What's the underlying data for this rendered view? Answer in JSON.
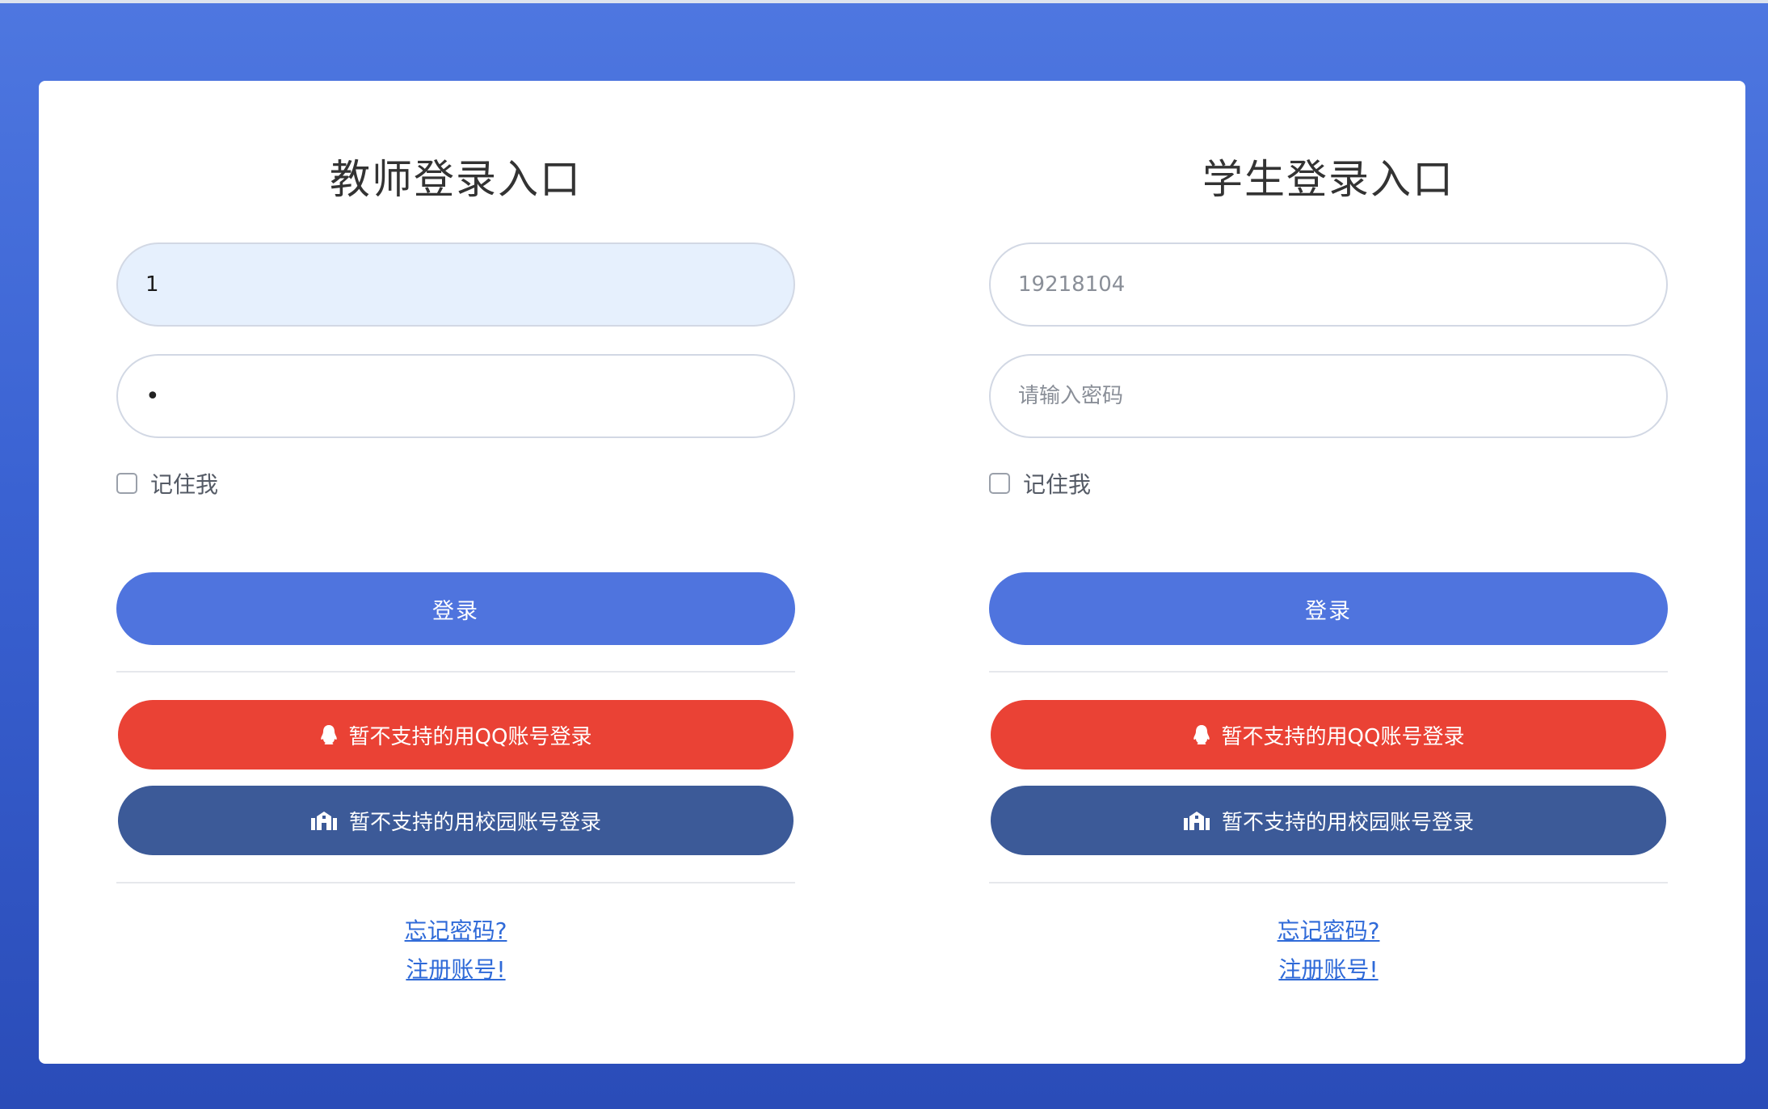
{
  "teacher": {
    "title": "教师登录入口",
    "username_value": "1",
    "password_value": "•",
    "remember_label": "记住我",
    "login_label": "登录",
    "qq_label": "暂不支持的用QQ账号登录",
    "campus_label": "暂不支持的用校园账号登录",
    "forgot_label": "忘记密码?",
    "register_label": "注册账号!"
  },
  "student": {
    "title": "学生登录入口",
    "username_placeholder": "19218104",
    "password_placeholder": "请输入密码",
    "remember_label": "记住我",
    "login_label": "登录",
    "qq_label": "暂不支持的用QQ账号登录",
    "campus_label": "暂不支持的用校园账号登录",
    "forgot_label": "忘记密码?",
    "register_label": "注册账号!"
  },
  "icons": {
    "qq": "qq-penguin-icon",
    "campus": "university-icon"
  },
  "colors": {
    "background_top": "#4e77e0",
    "background_bottom": "#2a4cb8",
    "login_button": "#4f74de",
    "qq_button": "#ea4235",
    "campus_button": "#3c5a98",
    "link": "#2f6ad8",
    "filled_input": "#e6f0fd"
  }
}
